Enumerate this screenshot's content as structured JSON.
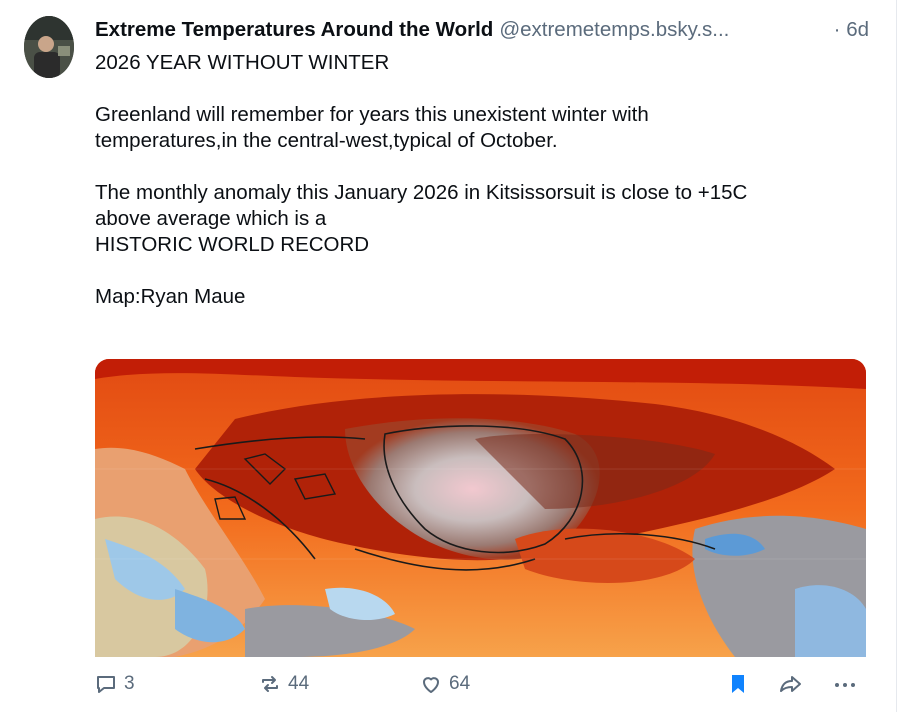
{
  "post": {
    "author_name": "Extreme Temperatures Around the World",
    "handle": "@extremetemps.bsky.s...",
    "time": "· 6d",
    "lines": [
      "2026 YEAR WITHOUT WINTER",
      "",
      "Greenland will remember for years this unexistent winter with",
      "temperatures,in the central-west,typical of October.",
      "",
      "The monthly anomaly this January 2026 in Kitsissorsuit is close to +15C",
      "above average which is a",
      "HISTORIC WORLD RECORD",
      "",
      "Map:Ryan Maue"
    ]
  },
  "actions": {
    "reply_count": "3",
    "repost_count": "44",
    "like_count": "64"
  },
  "icons": {
    "reply": "speech-bubble-icon",
    "repost": "repost-arrows-icon",
    "like": "heart-icon",
    "bookmark": "bookmark-icon",
    "share": "share-arrow-icon",
    "more": "more-dots-icon"
  },
  "colors": {
    "bookmark_active": "#1083fe",
    "muted": "#5b6b7c",
    "text": "#0b0f14"
  }
}
